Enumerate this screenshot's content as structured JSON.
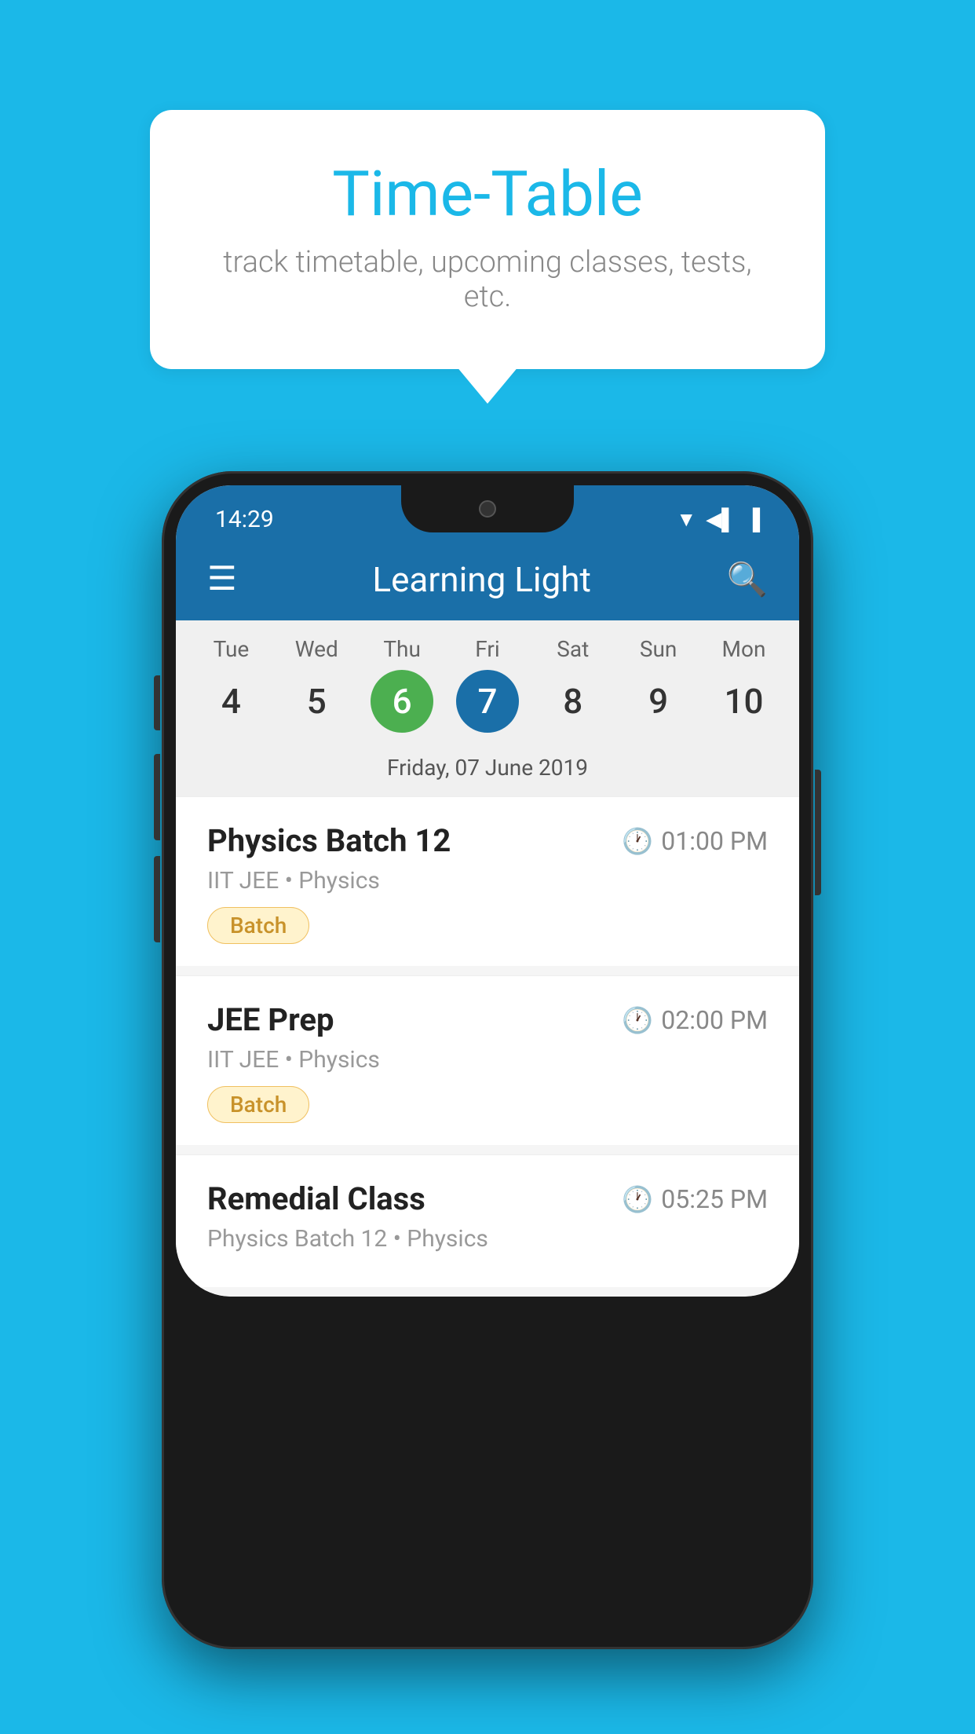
{
  "background_color": "#1BB8E8",
  "tooltip": {
    "title": "Time-Table",
    "subtitle": "track timetable, upcoming classes, tests, etc."
  },
  "phone": {
    "status_bar": {
      "time": "14:29"
    },
    "app_header": {
      "title": "Learning Light"
    },
    "calendar": {
      "days": [
        {
          "label": "Tue",
          "num": "4",
          "state": "normal"
        },
        {
          "label": "Wed",
          "num": "5",
          "state": "normal"
        },
        {
          "label": "Thu",
          "num": "6",
          "state": "today"
        },
        {
          "label": "Fri",
          "num": "7",
          "state": "selected"
        },
        {
          "label": "Sat",
          "num": "8",
          "state": "normal"
        },
        {
          "label": "Sun",
          "num": "9",
          "state": "normal"
        },
        {
          "label": "Mon",
          "num": "10",
          "state": "normal"
        }
      ],
      "selected_date_label": "Friday, 07 June 2019"
    },
    "events": [
      {
        "title": "Physics Batch 12",
        "time": "01:00 PM",
        "meta": "IIT JEE • Physics",
        "badge": "Batch"
      },
      {
        "title": "JEE Prep",
        "time": "02:00 PM",
        "meta": "IIT JEE • Physics",
        "badge": "Batch"
      },
      {
        "title": "Remedial Class",
        "time": "05:25 PM",
        "meta": "Physics Batch 12 • Physics",
        "badge": null
      }
    ]
  }
}
